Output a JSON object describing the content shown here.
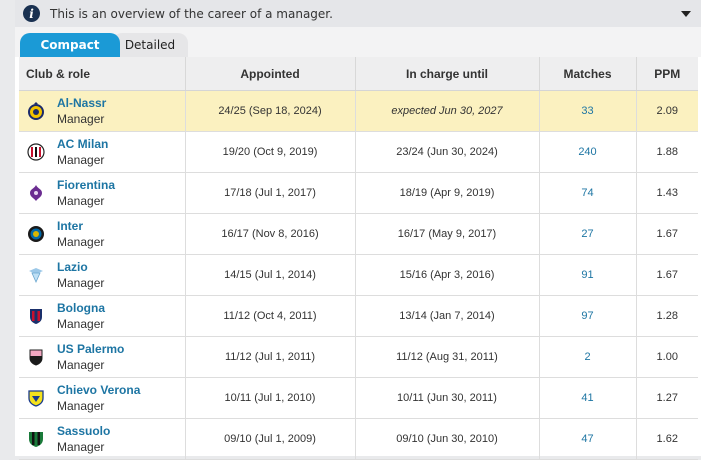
{
  "info": {
    "text": "This is an overview of the career of a manager.",
    "icon": "info-icon",
    "caret": "chevron-down-icon"
  },
  "tabs": [
    {
      "label": "Compact",
      "active": true
    },
    {
      "label": "Detailed",
      "active": false
    }
  ],
  "colors": {
    "accent": "#1b9ad6",
    "link": "#1d75a3",
    "highlight": "#fbf1c0"
  },
  "table": {
    "headers": {
      "club": "Club & role",
      "appointed": "Appointed",
      "until": "In charge until",
      "matches": "Matches",
      "ppm": "PPM"
    },
    "rows": [
      {
        "club": "Al-Nassr",
        "role": "Manager",
        "appointed": "24/25 (Sep 18, 2024)",
        "until": "expected Jun 30, 2027",
        "matches": "33",
        "ppm": "2.09",
        "crest": "al-nassr-crest"
      },
      {
        "club": "AC Milan",
        "role": "Manager",
        "appointed": "19/20 (Oct 9, 2019)",
        "until": "23/24 (Jun 30, 2024)",
        "matches": "240",
        "ppm": "1.88",
        "crest": "ac-milan-crest"
      },
      {
        "club": "Fiorentina",
        "role": "Manager",
        "appointed": "17/18 (Jul 1, 2017)",
        "until": "18/19 (Apr 9, 2019)",
        "matches": "74",
        "ppm": "1.43",
        "crest": "fiorentina-crest"
      },
      {
        "club": "Inter",
        "role": "Manager",
        "appointed": "16/17 (Nov 8, 2016)",
        "until": "16/17 (May 9, 2017)",
        "matches": "27",
        "ppm": "1.67",
        "crest": "inter-crest"
      },
      {
        "club": "Lazio",
        "role": "Manager",
        "appointed": "14/15 (Jul 1, 2014)",
        "until": "15/16 (Apr 3, 2016)",
        "matches": "91",
        "ppm": "1.67",
        "crest": "lazio-crest"
      },
      {
        "club": "Bologna",
        "role": "Manager",
        "appointed": "11/12 (Oct 4, 2011)",
        "until": "13/14 (Jan 7, 2014)",
        "matches": "97",
        "ppm": "1.28",
        "crest": "bologna-crest"
      },
      {
        "club": "US Palermo",
        "role": "Manager",
        "appointed": "11/12 (Jul 1, 2011)",
        "until": "11/12 (Aug 31, 2011)",
        "matches": "2",
        "ppm": "1.00",
        "crest": "palermo-crest"
      },
      {
        "club": "Chievo Verona",
        "role": "Manager",
        "appointed": "10/11 (Jul 1, 2010)",
        "until": "10/11 (Jun 30, 2011)",
        "matches": "41",
        "ppm": "1.27",
        "crest": "chievo-crest"
      },
      {
        "club": "Sassuolo",
        "role": "Manager",
        "appointed": "09/10 (Jul 1, 2009)",
        "until": "09/10 (Jun 30, 2010)",
        "matches": "47",
        "ppm": "1.62",
        "crest": "sassuolo-crest"
      }
    ]
  }
}
